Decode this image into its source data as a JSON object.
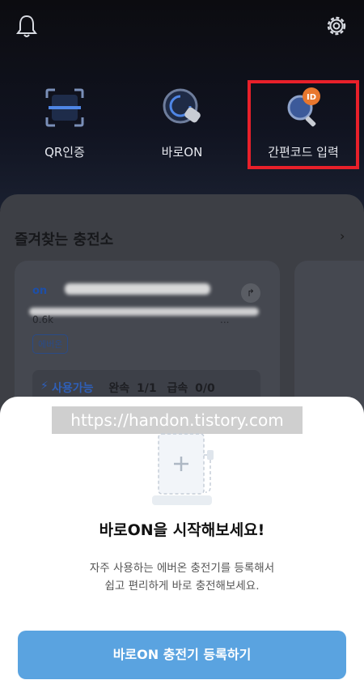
{
  "header": {
    "bell_icon": "bell-icon",
    "gear_icon": "gear-icon"
  },
  "quick_actions": [
    {
      "label": "QR인증",
      "icon": "qr-scan-icon"
    },
    {
      "label": "바로ON",
      "icon": "baro-on-icon"
    },
    {
      "label": "간편코드 입력",
      "icon": "id-search-icon",
      "highlighted": true
    }
  ],
  "favorites": {
    "title": "즐겨찾는 충전소",
    "chevron": "›",
    "card": {
      "logo": "on",
      "address_tail": "0.6k",
      "address_suffix": "...",
      "tag": "에버온",
      "status": "사용가능",
      "slow_label": "완속",
      "slow_value": "1/1",
      "fast_label": "급속",
      "fast_value": "0/0"
    }
  },
  "watermark": "https://handon.tistory.com",
  "sheet": {
    "title": "바로ON을 시작해보세요!",
    "desc_line1": "자주 사용하는 에버온 충전기를 등록해서",
    "desc_line2": "쉽고 편리하게 바로 충전해보세요.",
    "button": "바로ON 충전기 등록하기"
  },
  "colors": {
    "highlight": "#e8202a",
    "button": "#5aa3e0",
    "brand_blue": "#2f5fb8"
  }
}
